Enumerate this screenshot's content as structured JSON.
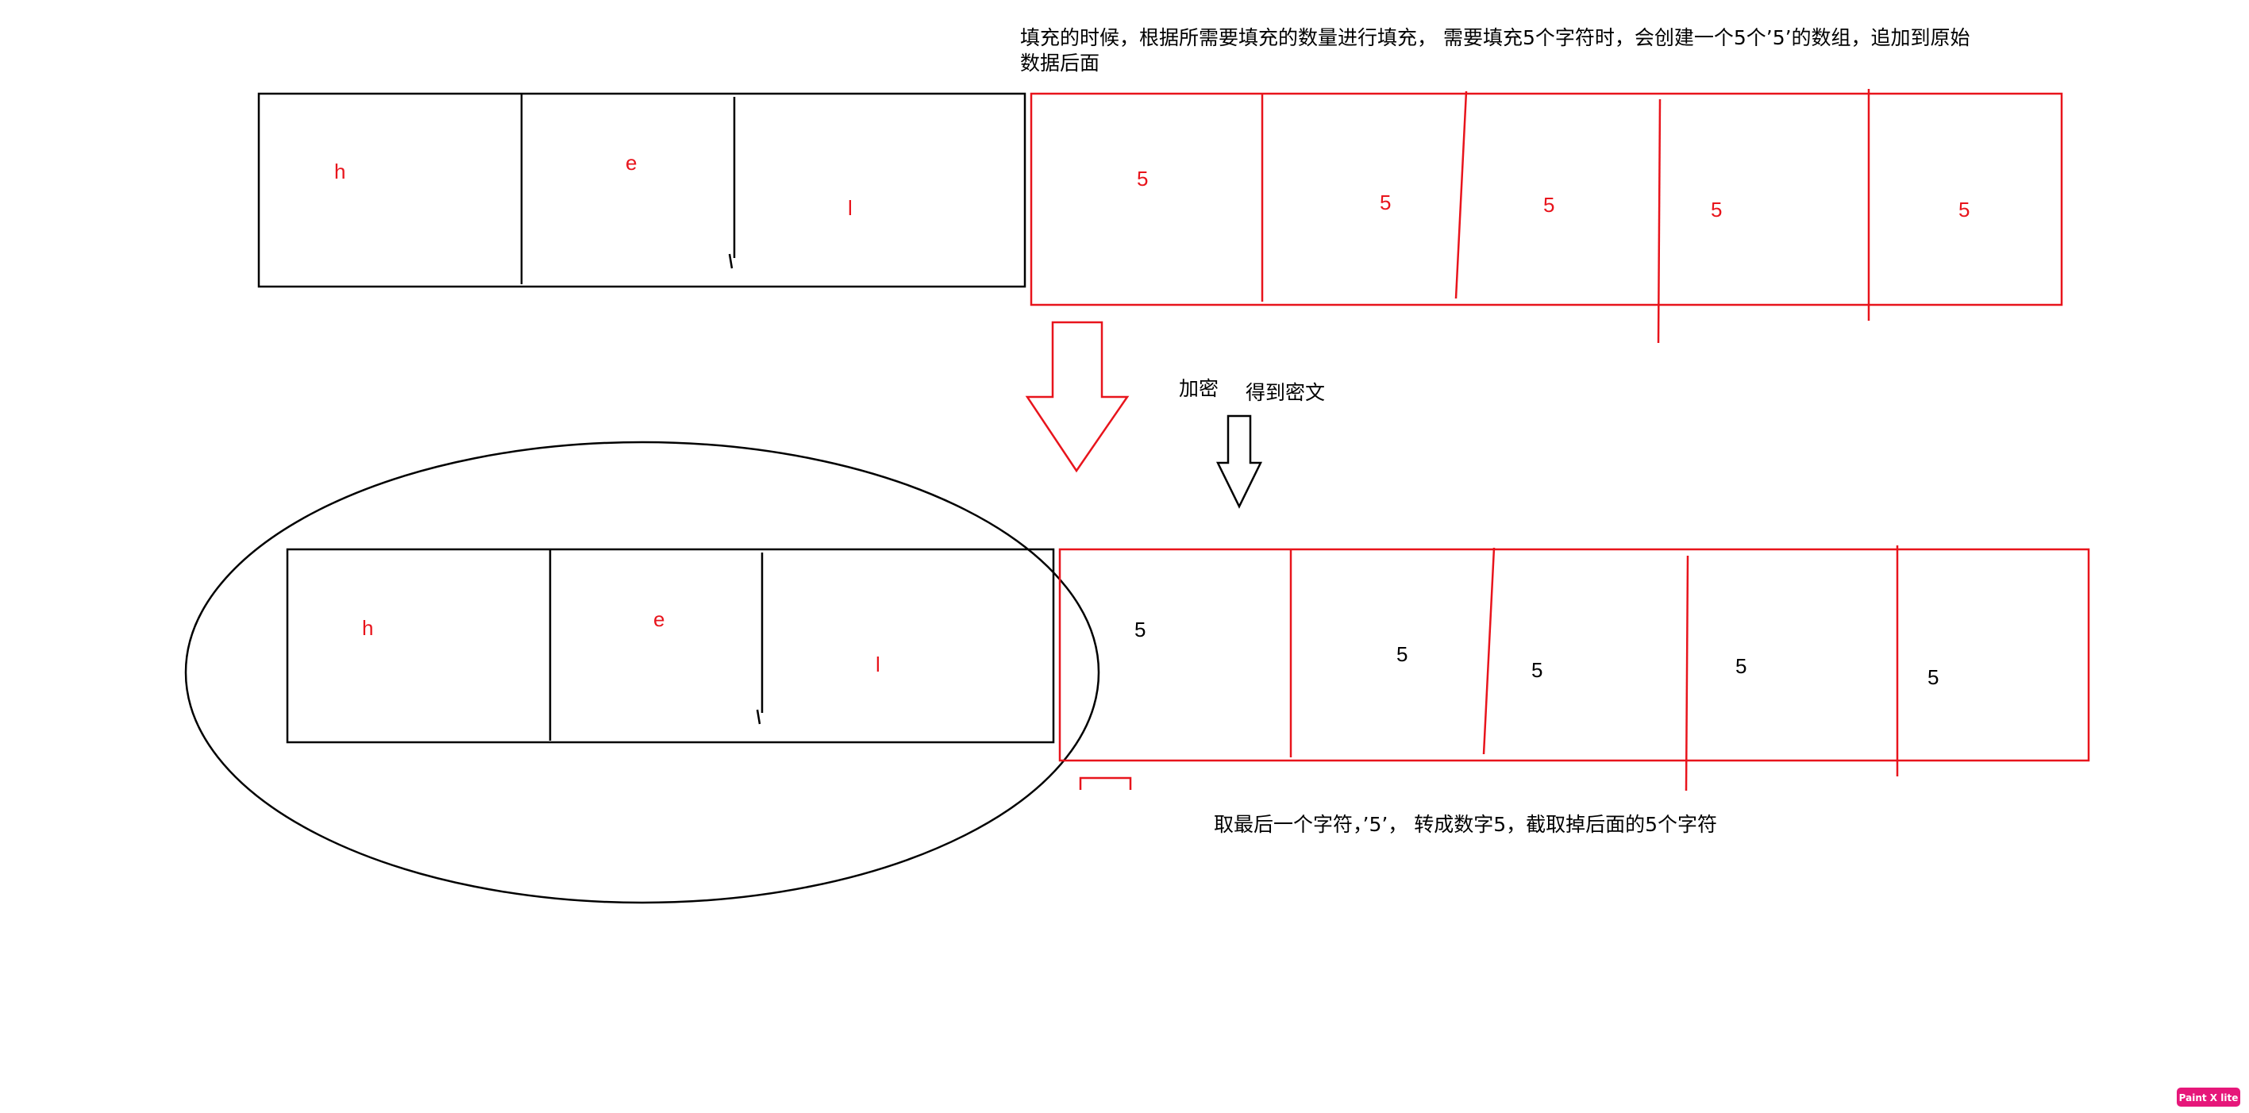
{
  "annotations": {
    "padding_note_line1": "填充的时候，根据所需要填充的数量进行填充，  需要填充5个字符时，会创建一个5个’5’的数组，追加到原始",
    "padding_note_line2": "数据后面",
    "encrypt_label": "加密",
    "ciphertext_label": "得到密文",
    "unpad_note": "取最后一个字符，’5’， 转成数字5，截取掉后面的5个字符"
  },
  "original_data": {
    "cells": [
      "h",
      "e",
      "l"
    ]
  },
  "padding": {
    "values": [
      "5",
      "5",
      "5",
      "5",
      "5"
    ]
  },
  "result_data": {
    "cells": [
      "h",
      "e",
      "l"
    ]
  },
  "result_padding": {
    "values": [
      "5",
      "5",
      "5",
      "5",
      "5"
    ]
  },
  "watermark": {
    "label": "Paint X lite"
  },
  "colors": {
    "accent_red": "#e8141c",
    "stroke_black": "#000000",
    "badge_pink": "#e6177a"
  }
}
